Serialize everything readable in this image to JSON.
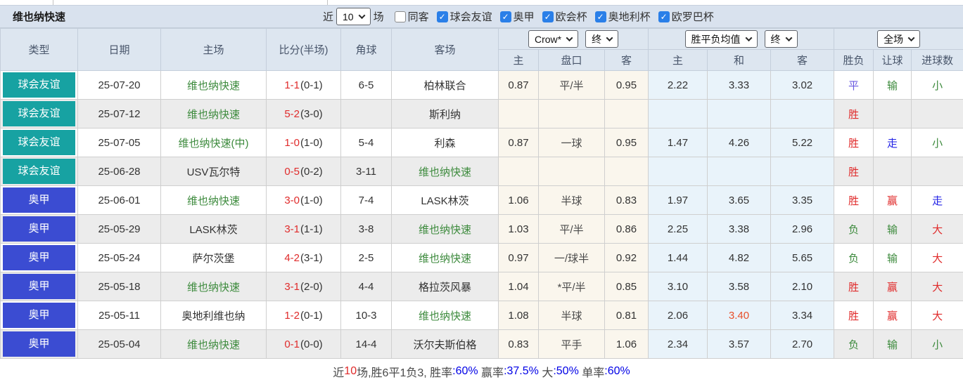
{
  "title": "维也纳快速",
  "colors": {
    "badge_friendly": "#17a2a2",
    "badge_league": "#3b4cd2",
    "team_green": "#3c8a3c",
    "score_red": "#e02b2b",
    "red": "#e02b2b",
    "green": "#3c8a3c",
    "blue": "#2222e6",
    "purple": "#6a5ae0",
    "hot": "#e8502a",
    "stat_blue": "#0000e6",
    "check_blue": "#2a7fe8",
    "footer_dark": "#4a4a4a"
  },
  "filter_bar": {
    "recent_label": "近",
    "recent_value": "10",
    "matches_label": "场",
    "checkboxes": [
      {
        "label": "同客",
        "checked": false
      },
      {
        "label": "球会友谊",
        "checked": true
      },
      {
        "label": "奥甲",
        "checked": true
      },
      {
        "label": "欧会杯",
        "checked": true
      },
      {
        "label": "奥地利杯",
        "checked": true
      },
      {
        "label": "欧罗巴杯",
        "checked": true
      }
    ]
  },
  "table": {
    "main_headers": [
      "类型",
      "日期",
      "主场",
      "比分(半场)",
      "角球",
      "客场"
    ],
    "selects": {
      "company": "Crow*",
      "company_time": "终",
      "avg": "胜平负均值",
      "avg_time": "终",
      "scope": "全场"
    },
    "sub_headers": [
      "主",
      "盘口",
      "客",
      "主",
      "和",
      "客",
      "胜负",
      "让球",
      "进球数"
    ],
    "rows": [
      {
        "type": "球会友谊",
        "kind": "friendly",
        "date": "25-07-20",
        "home": "维也纳快速",
        "home_green": true,
        "score": "1-1",
        "half": "(0-1)",
        "corner": "6-5",
        "away": "柏林联合",
        "away_green": false,
        "odds_home": "0.87",
        "handicap": "平/半",
        "odds_away": "0.95",
        "avg_home": "2.22",
        "avg_draw": "3.33",
        "avg_away": "3.02",
        "avg_draw_hot": false,
        "result": {
          "t": "平",
          "c": "purple"
        },
        "let": {
          "t": "输",
          "c": "green"
        },
        "goals": {
          "t": "小",
          "c": "green"
        }
      },
      {
        "type": "球会友谊",
        "kind": "friendly",
        "date": "25-07-12",
        "home": "维也纳快速",
        "home_green": true,
        "score": "5-2",
        "half": "(3-0)",
        "corner": "",
        "away": "斯利纳",
        "away_green": false,
        "odds_home": "",
        "handicap": "",
        "odds_away": "",
        "avg_home": "",
        "avg_draw": "",
        "avg_away": "",
        "avg_draw_hot": false,
        "result": {
          "t": "胜",
          "c": "red"
        },
        "let": {
          "t": "",
          "c": ""
        },
        "goals": {
          "t": "",
          "c": ""
        }
      },
      {
        "type": "球会友谊",
        "kind": "friendly",
        "date": "25-07-05",
        "home": "维也纳快速(中)",
        "home_green": true,
        "score": "1-0",
        "half": "(1-0)",
        "corner": "5-4",
        "away": "利森",
        "away_green": false,
        "odds_home": "0.87",
        "handicap": "一球",
        "odds_away": "0.95",
        "avg_home": "1.47",
        "avg_draw": "4.26",
        "avg_away": "5.22",
        "avg_draw_hot": false,
        "result": {
          "t": "胜",
          "c": "red"
        },
        "let": {
          "t": "走",
          "c": "blue"
        },
        "goals": {
          "t": "小",
          "c": "green"
        }
      },
      {
        "type": "球会友谊",
        "kind": "friendly",
        "date": "25-06-28",
        "home": "USV瓦尔特",
        "home_green": false,
        "score": "0-5",
        "half": "(0-2)",
        "corner": "3-11",
        "away": "维也纳快速",
        "away_green": true,
        "odds_home": "",
        "handicap": "",
        "odds_away": "",
        "avg_home": "",
        "avg_draw": "",
        "avg_away": "",
        "avg_draw_hot": false,
        "result": {
          "t": "胜",
          "c": "red"
        },
        "let": {
          "t": "",
          "c": ""
        },
        "goals": {
          "t": "",
          "c": ""
        }
      },
      {
        "type": "奥甲",
        "kind": "league",
        "date": "25-06-01",
        "home": "维也纳快速",
        "home_green": true,
        "score": "3-0",
        "half": "(1-0)",
        "corner": "7-4",
        "away": "LASK林茨",
        "away_green": false,
        "odds_home": "1.06",
        "handicap": "半球",
        "odds_away": "0.83",
        "avg_home": "1.97",
        "avg_draw": "3.65",
        "avg_away": "3.35",
        "avg_draw_hot": false,
        "result": {
          "t": "胜",
          "c": "red"
        },
        "let": {
          "t": "赢",
          "c": "red"
        },
        "goals": {
          "t": "走",
          "c": "blue"
        }
      },
      {
        "type": "奥甲",
        "kind": "league",
        "date": "25-05-29",
        "home": "LASK林茨",
        "home_green": false,
        "score": "3-1",
        "half": "(1-1)",
        "corner": "3-8",
        "away": "维也纳快速",
        "away_green": true,
        "odds_home": "1.03",
        "handicap": "平/半",
        "odds_away": "0.86",
        "avg_home": "2.25",
        "avg_draw": "3.38",
        "avg_away": "2.96",
        "avg_draw_hot": false,
        "result": {
          "t": "负",
          "c": "green"
        },
        "let": {
          "t": "输",
          "c": "green"
        },
        "goals": {
          "t": "大",
          "c": "red"
        }
      },
      {
        "type": "奥甲",
        "kind": "league",
        "date": "25-05-24",
        "home": "萨尔茨堡",
        "home_green": false,
        "score": "4-2",
        "half": "(3-1)",
        "corner": "2-5",
        "away": "维也纳快速",
        "away_green": true,
        "odds_home": "0.97",
        "handicap": "一/球半",
        "odds_away": "0.92",
        "avg_home": "1.44",
        "avg_draw": "4.82",
        "avg_away": "5.65",
        "avg_draw_hot": false,
        "result": {
          "t": "负",
          "c": "green"
        },
        "let": {
          "t": "输",
          "c": "green"
        },
        "goals": {
          "t": "大",
          "c": "red"
        }
      },
      {
        "type": "奥甲",
        "kind": "league",
        "date": "25-05-18",
        "home": "维也纳快速",
        "home_green": true,
        "score": "3-1",
        "half": "(2-0)",
        "corner": "4-4",
        "away": "格拉茨风暴",
        "away_green": false,
        "odds_home": "1.04",
        "handicap": "*平/半",
        "odds_away": "0.85",
        "avg_home": "3.10",
        "avg_draw": "3.58",
        "avg_away": "2.10",
        "avg_draw_hot": false,
        "result": {
          "t": "胜",
          "c": "red"
        },
        "let": {
          "t": "赢",
          "c": "red"
        },
        "goals": {
          "t": "大",
          "c": "red"
        }
      },
      {
        "type": "奥甲",
        "kind": "league",
        "date": "25-05-11",
        "home": "奥地利维也纳",
        "home_green": false,
        "score": "1-2",
        "half": "(0-1)",
        "corner": "10-3",
        "away": "维也纳快速",
        "away_green": true,
        "odds_home": "1.08",
        "handicap": "半球",
        "odds_away": "0.81",
        "avg_home": "2.06",
        "avg_draw": "3.40",
        "avg_away": "3.34",
        "avg_draw_hot": true,
        "result": {
          "t": "胜",
          "c": "red"
        },
        "let": {
          "t": "赢",
          "c": "red"
        },
        "goals": {
          "t": "大",
          "c": "red"
        }
      },
      {
        "type": "奥甲",
        "kind": "league",
        "date": "25-05-04",
        "home": "维也纳快速",
        "home_green": true,
        "score": "0-1",
        "half": "(0-0)",
        "corner": "14-4",
        "away": "沃尔夫斯伯格",
        "away_green": false,
        "odds_home": "0.83",
        "handicap": "平手",
        "odds_away": "1.06",
        "avg_home": "2.34",
        "avg_draw": "3.57",
        "avg_away": "2.70",
        "avg_draw_hot": false,
        "result": {
          "t": "负",
          "c": "green"
        },
        "let": {
          "t": "输",
          "c": "green"
        },
        "goals": {
          "t": "小",
          "c": "green"
        }
      }
    ]
  },
  "footer": {
    "segments": [
      {
        "t": "近",
        "c": "dark"
      },
      {
        "t": "10",
        "c": "red"
      },
      {
        "t": "场,胜6平1负3, 胜率",
        "c": "dark"
      },
      {
        "t": ":60%",
        "c": "blue"
      },
      {
        "t": " 赢率",
        "c": "dark"
      },
      {
        "t": ":37.5%",
        "c": "blue"
      },
      {
        "t": " 大",
        "c": "dark"
      },
      {
        "t": ":50%",
        "c": "blue"
      },
      {
        "t": " 单率",
        "c": "dark"
      },
      {
        "t": ":60%",
        "c": "blue"
      }
    ]
  }
}
